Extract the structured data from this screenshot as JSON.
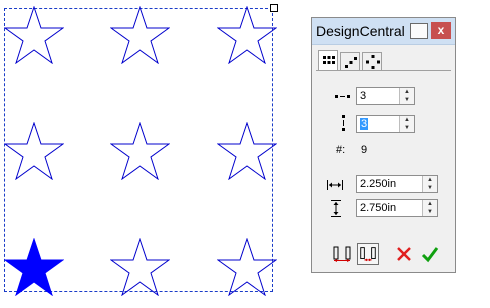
{
  "canvas": {
    "star_rows": 3,
    "star_cols": 3,
    "star_color": "#0000cc",
    "selected_star_color": "#0000ff",
    "selection_color": "#1a3cc8"
  },
  "dialog": {
    "title": "DesignCentral",
    "close_label": "x",
    "tabs": [
      {
        "name": "grid-array-icon",
        "active": true
      },
      {
        "name": "line-array-icon",
        "active": false
      },
      {
        "name": "circle-array-icon",
        "active": false
      }
    ],
    "columns_value": "3",
    "rows_value": "3",
    "count_label": "#:",
    "count_value": "9",
    "h_spacing_value": "2.250in",
    "v_spacing_value": "2.750in",
    "colors": {
      "titlebar": "#cfe0f3",
      "close": "#c75050",
      "cancel": "#e02020",
      "ok": "#10a010",
      "selection_highlight": "#3399ff"
    },
    "buttons": [
      {
        "name": "spacing-mode-1-button"
      },
      {
        "name": "spacing-mode-2-button"
      },
      {
        "name": "cancel-button"
      },
      {
        "name": "ok-button"
      }
    ]
  }
}
